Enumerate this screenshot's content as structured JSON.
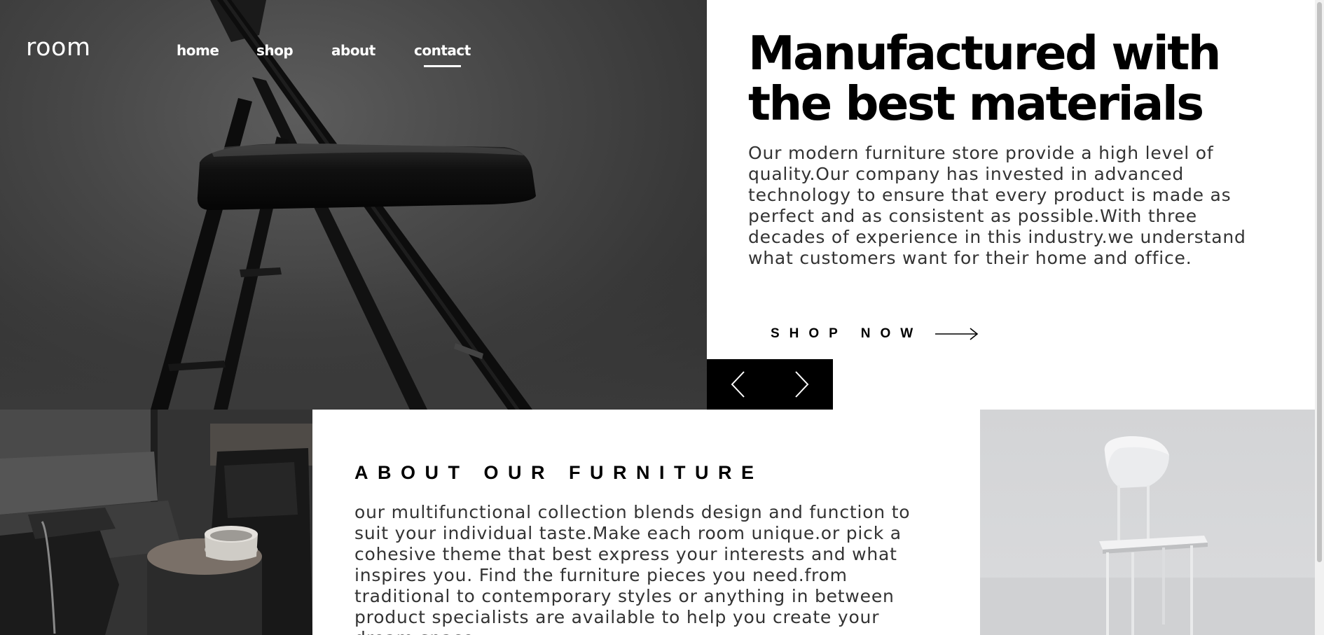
{
  "nav": {
    "logo": "room",
    "links": [
      {
        "label": "home",
        "active": false
      },
      {
        "label": "shop",
        "active": false
      },
      {
        "label": "about",
        "active": false
      },
      {
        "label": "contact",
        "active": true
      }
    ]
  },
  "hero": {
    "title": "Manufactured with the best materials",
    "body": "Our modern furniture store provide a high level of quality.Our company has invested in advanced technology to ensure that every product is made as perfect and as consistent as possible.With three decades of experience in this industry.we understand what customers want for their home and office.",
    "cta_label": "SHOP NOW",
    "cta_icon": "arrow-right-icon",
    "image": "black-folding-chair-image"
  },
  "slider": {
    "prev_icon": "chevron-left-icon",
    "next_icon": "chevron-right-icon"
  },
  "about": {
    "title": "ABOUT OUR FURNITURE",
    "body": "our multifunctional collection blends design and function to suit your individual taste.Make each room unique.or pick a cohesive theme that best express your interests and what inspires you. Find the furniture pieces you need.from traditional to contemporary styles or anything in between product specialists are available to help you create your dream space.",
    "left_image": "dark-living-room-image",
    "right_image": "white-chair-image"
  },
  "colors": {
    "accent": "#000000",
    "text": "#333333",
    "hero_bg": "#474747",
    "light_bg": "#d8d9db"
  }
}
